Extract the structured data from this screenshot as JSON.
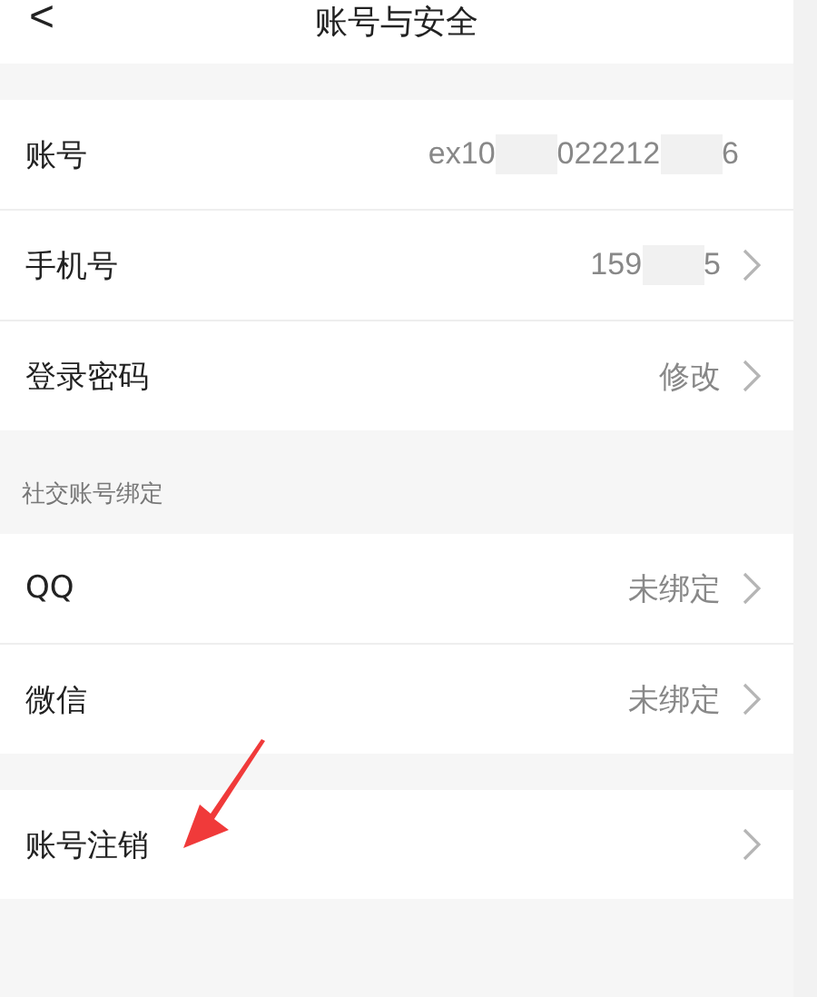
{
  "header": {
    "back": "<",
    "title": "账号与安全"
  },
  "groups": [
    {
      "rows": [
        {
          "label": "账号",
          "value_parts": [
            "ex10",
            "022212",
            "6"
          ],
          "chevron": false
        },
        {
          "label": "手机号",
          "value_parts": [
            "159",
            "5"
          ],
          "chevron": true
        },
        {
          "label": "登录密码",
          "value_parts": [
            "修改"
          ],
          "chevron": true
        }
      ]
    },
    {
      "heading": "社交账号绑定",
      "rows": [
        {
          "label": "QQ",
          "value_parts": [
            "未绑定"
          ],
          "chevron": true
        },
        {
          "label": "微信",
          "value_parts": [
            "未绑定"
          ],
          "chevron": true
        }
      ]
    },
    {
      "rows": [
        {
          "label": "账号注销",
          "value_parts": [],
          "chevron": true,
          "annotated": true
        }
      ]
    }
  ]
}
